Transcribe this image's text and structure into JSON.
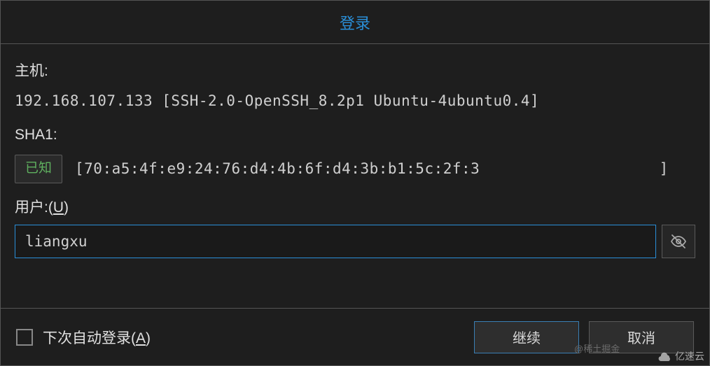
{
  "title": "登录",
  "labels": {
    "host": "主机:",
    "sha1": "SHA1:",
    "user_prefix": "用户:(",
    "user_key": "U",
    "user_suffix": ")",
    "auto_login_prefix": "下次自动登录(",
    "auto_login_key": "A",
    "auto_login_suffix": ")"
  },
  "host_info": "192.168.107.133 [SSH-2.0-OpenSSH_8.2p1 Ubuntu-4ubuntu0.4]",
  "sha1": {
    "known_label": "已知",
    "fingerprint": "[70:a5:4f:e9:24:76:d4:4b:6f:d4:3b:b1:5c:2f:3",
    "fingerprint_end": "]"
  },
  "user_input": "liangxu",
  "buttons": {
    "continue": "继续",
    "cancel": "取消"
  },
  "watermarks": {
    "left": "@稀土掘金",
    "right": "亿速云"
  }
}
